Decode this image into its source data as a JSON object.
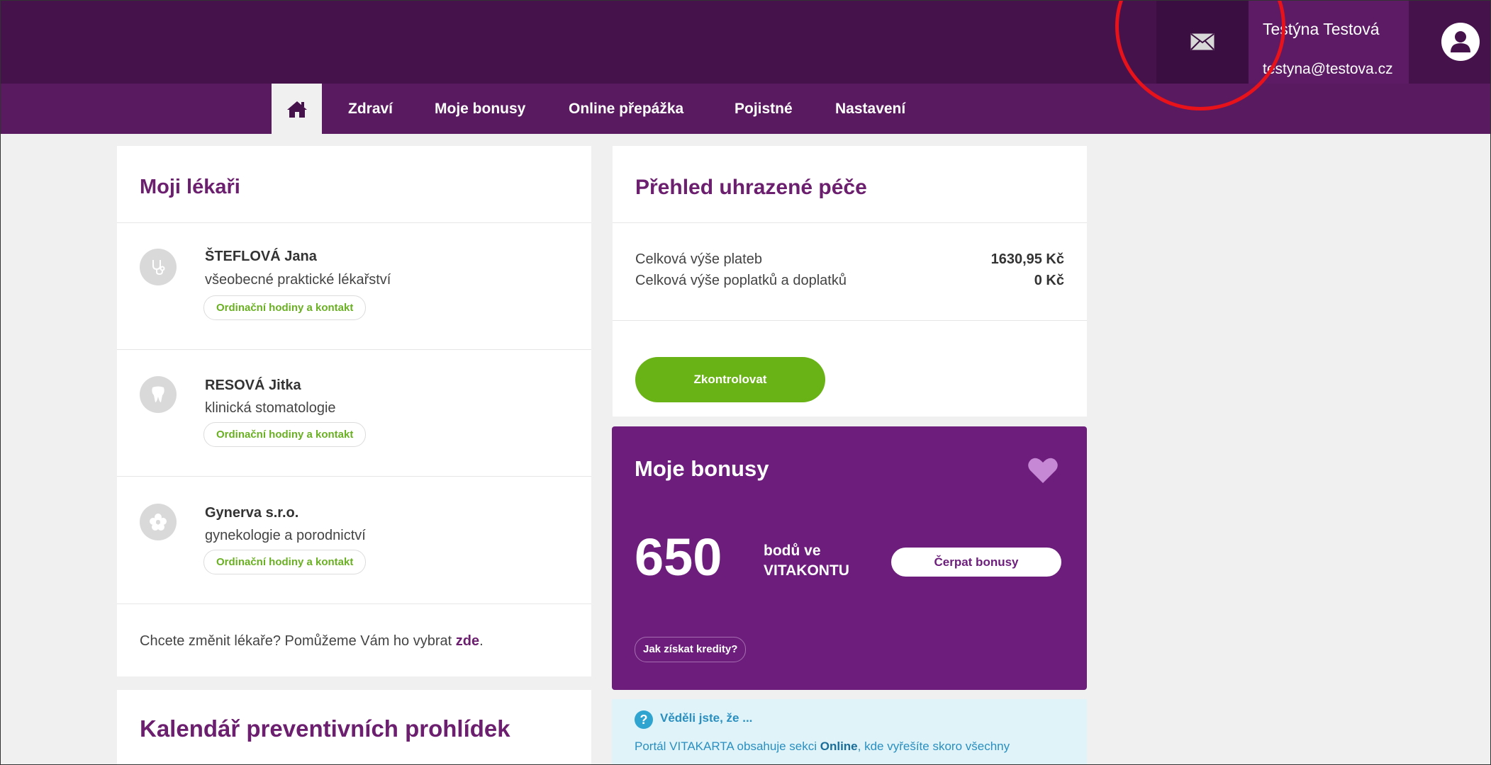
{
  "header": {
    "user_name": "Testýna Testová",
    "user_email": "testyna@testova.cz",
    "mail_icon": "envelope-icon",
    "avatar_icon": "user-icon"
  },
  "nav": {
    "home_icon": "home-icon",
    "items": [
      "Zdraví",
      "Moje bonusy",
      "Online přepážka",
      "Pojistné",
      "Nastavení"
    ]
  },
  "doctors_card": {
    "title": "Moji lékaři",
    "doctors": [
      {
        "name": "ŠTEFLOVÁ Jana",
        "specialty": "všeobecné praktické lékařství",
        "link": "Ordinační hodiny a kontakt",
        "icon": "stethoscope-icon"
      },
      {
        "name": "RESOVÁ Jitka",
        "specialty": "klinická stomatologie",
        "link": "Ordinační hodiny a kontakt",
        "icon": "tooth-icon"
      },
      {
        "name": "Gynerva s.r.o.",
        "specialty": "gynekologie a porodnictví",
        "link": "Ordinační hodiny a kontakt",
        "icon": "flower-icon"
      }
    ],
    "footer_text": "Chcete změnit lékaře? Pomůžeme Vám ho vybrat ",
    "footer_link": "zde",
    "footer_end": "."
  },
  "calendar_card": {
    "title": "Kalendář preventivních prohlídek"
  },
  "payments_card": {
    "title": "Přehled uhrazené péče",
    "rows": [
      {
        "label": "Celková výše plateb",
        "value": "1630,95 Kč"
      },
      {
        "label": "Celková výše poplatků a doplatků",
        "value": "0 Kč"
      }
    ],
    "button": "Zkontrolovat"
  },
  "bonus_card": {
    "title": "Moje bonusy",
    "points": "650",
    "points_label_line1": "bodů ve",
    "points_label_line2": "VITAKONTU",
    "button": "Čerpat bonusy",
    "link": "Jak získat kredity?",
    "heart_icon": "heart-icon"
  },
  "info_card": {
    "title": "Věděli jste, že ...",
    "text_before": "Portál VITAKARTA obsahuje sekci ",
    "text_bold": "Online",
    "text_after": ", kde vyřešíte skoro všechny"
  },
  "colors": {
    "topbar": "#46124c",
    "navbar": "#5a1a5f",
    "accent_purple": "#6d1e7c",
    "green": "#6ab316",
    "info_bg": "#dff3f8",
    "annotation_red": "#e8121b"
  }
}
